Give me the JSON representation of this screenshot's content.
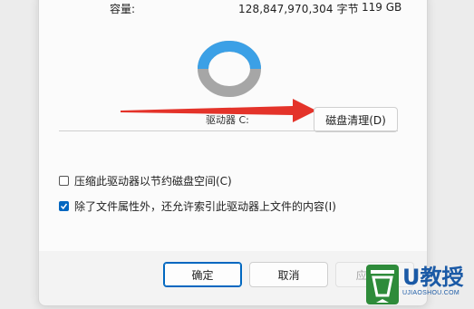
{
  "properties": {
    "capacity_label": "容量:",
    "capacity_bytes": "128,847,970,304 字节",
    "capacity_gb": "119 GB",
    "drive_label": "驱动器 C:",
    "cleanup_button": "磁盘清理(D)",
    "compress_option": "压缩此驱动器以节约磁盘空间(C)",
    "compress_checked": false,
    "index_option": "除了文件属性外，还允许索引此驱动器上文件的内容(I)",
    "index_checked": true
  },
  "usage": {
    "used_fraction": 0.3,
    "used_color": "#3ba0e6",
    "free_color": "#a6a6a6"
  },
  "footer": {
    "ok": "确定",
    "cancel": "取消",
    "apply": "应用(A)"
  },
  "annotation": {
    "arrow_color": "#e4332a"
  },
  "watermark": {
    "title": "U教授",
    "url": "UJIAOSHOU.COM",
    "badge_color": "#2e8b3a",
    "text_color": "#1b5aa6"
  }
}
